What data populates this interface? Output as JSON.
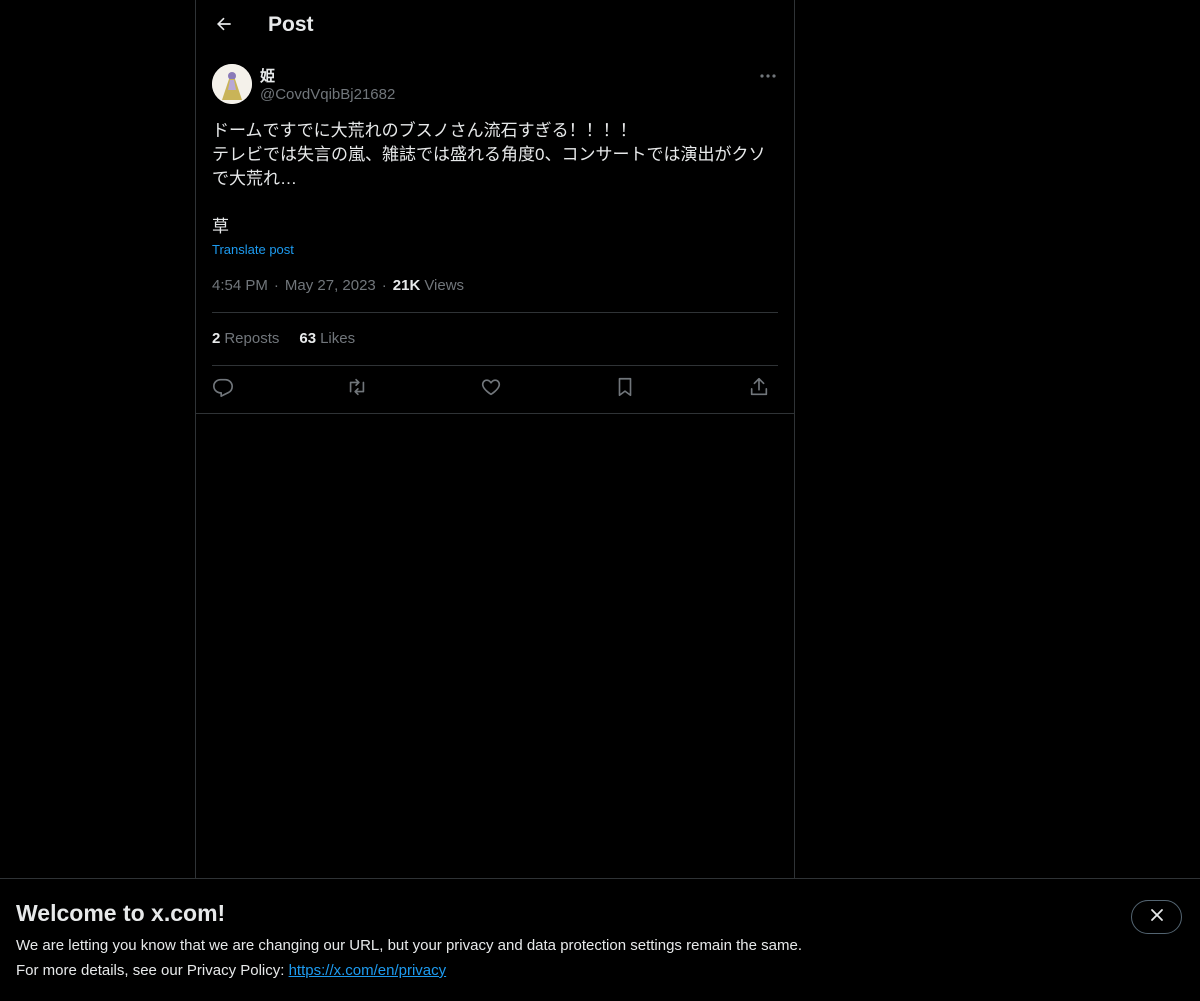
{
  "header": {
    "title": "Post"
  },
  "post": {
    "display_name": "姫",
    "handle": "@CovdVqibBj21682",
    "text": "ドームですでに大荒れのブスノさん流石すぎる！！！！\nテレビでは失言の嵐、雑誌では盛れる角度0、コンサートでは演出がクソで大荒れ…\n\n草",
    "translate_label": "Translate post",
    "time": "4:54 PM",
    "date": "May 27, 2023",
    "views_count": "21K",
    "views_label": "Views",
    "separator": "·",
    "reposts_count": "2",
    "reposts_label": "Reposts",
    "likes_count": "63",
    "likes_label": "Likes"
  },
  "icons": {
    "back": "back-arrow-icon",
    "more": "more-icon",
    "reply": "reply-icon",
    "repost": "repost-icon",
    "like": "heart-icon",
    "bookmark": "bookmark-icon",
    "share": "share-icon",
    "close": "close-icon"
  },
  "banner": {
    "title": "Welcome to x.com!",
    "line1": "We are letting you know that we are changing our URL, but your privacy and data protection settings remain the same.",
    "line2_prefix": "For more details, see our Privacy Policy: ",
    "link_text": "https://x.com/en/privacy"
  },
  "colors": {
    "background": "#000000",
    "text_primary": "#e7e9ea",
    "text_secondary": "#71767b",
    "accent": "#1d9bf0",
    "border": "#2f3336"
  }
}
